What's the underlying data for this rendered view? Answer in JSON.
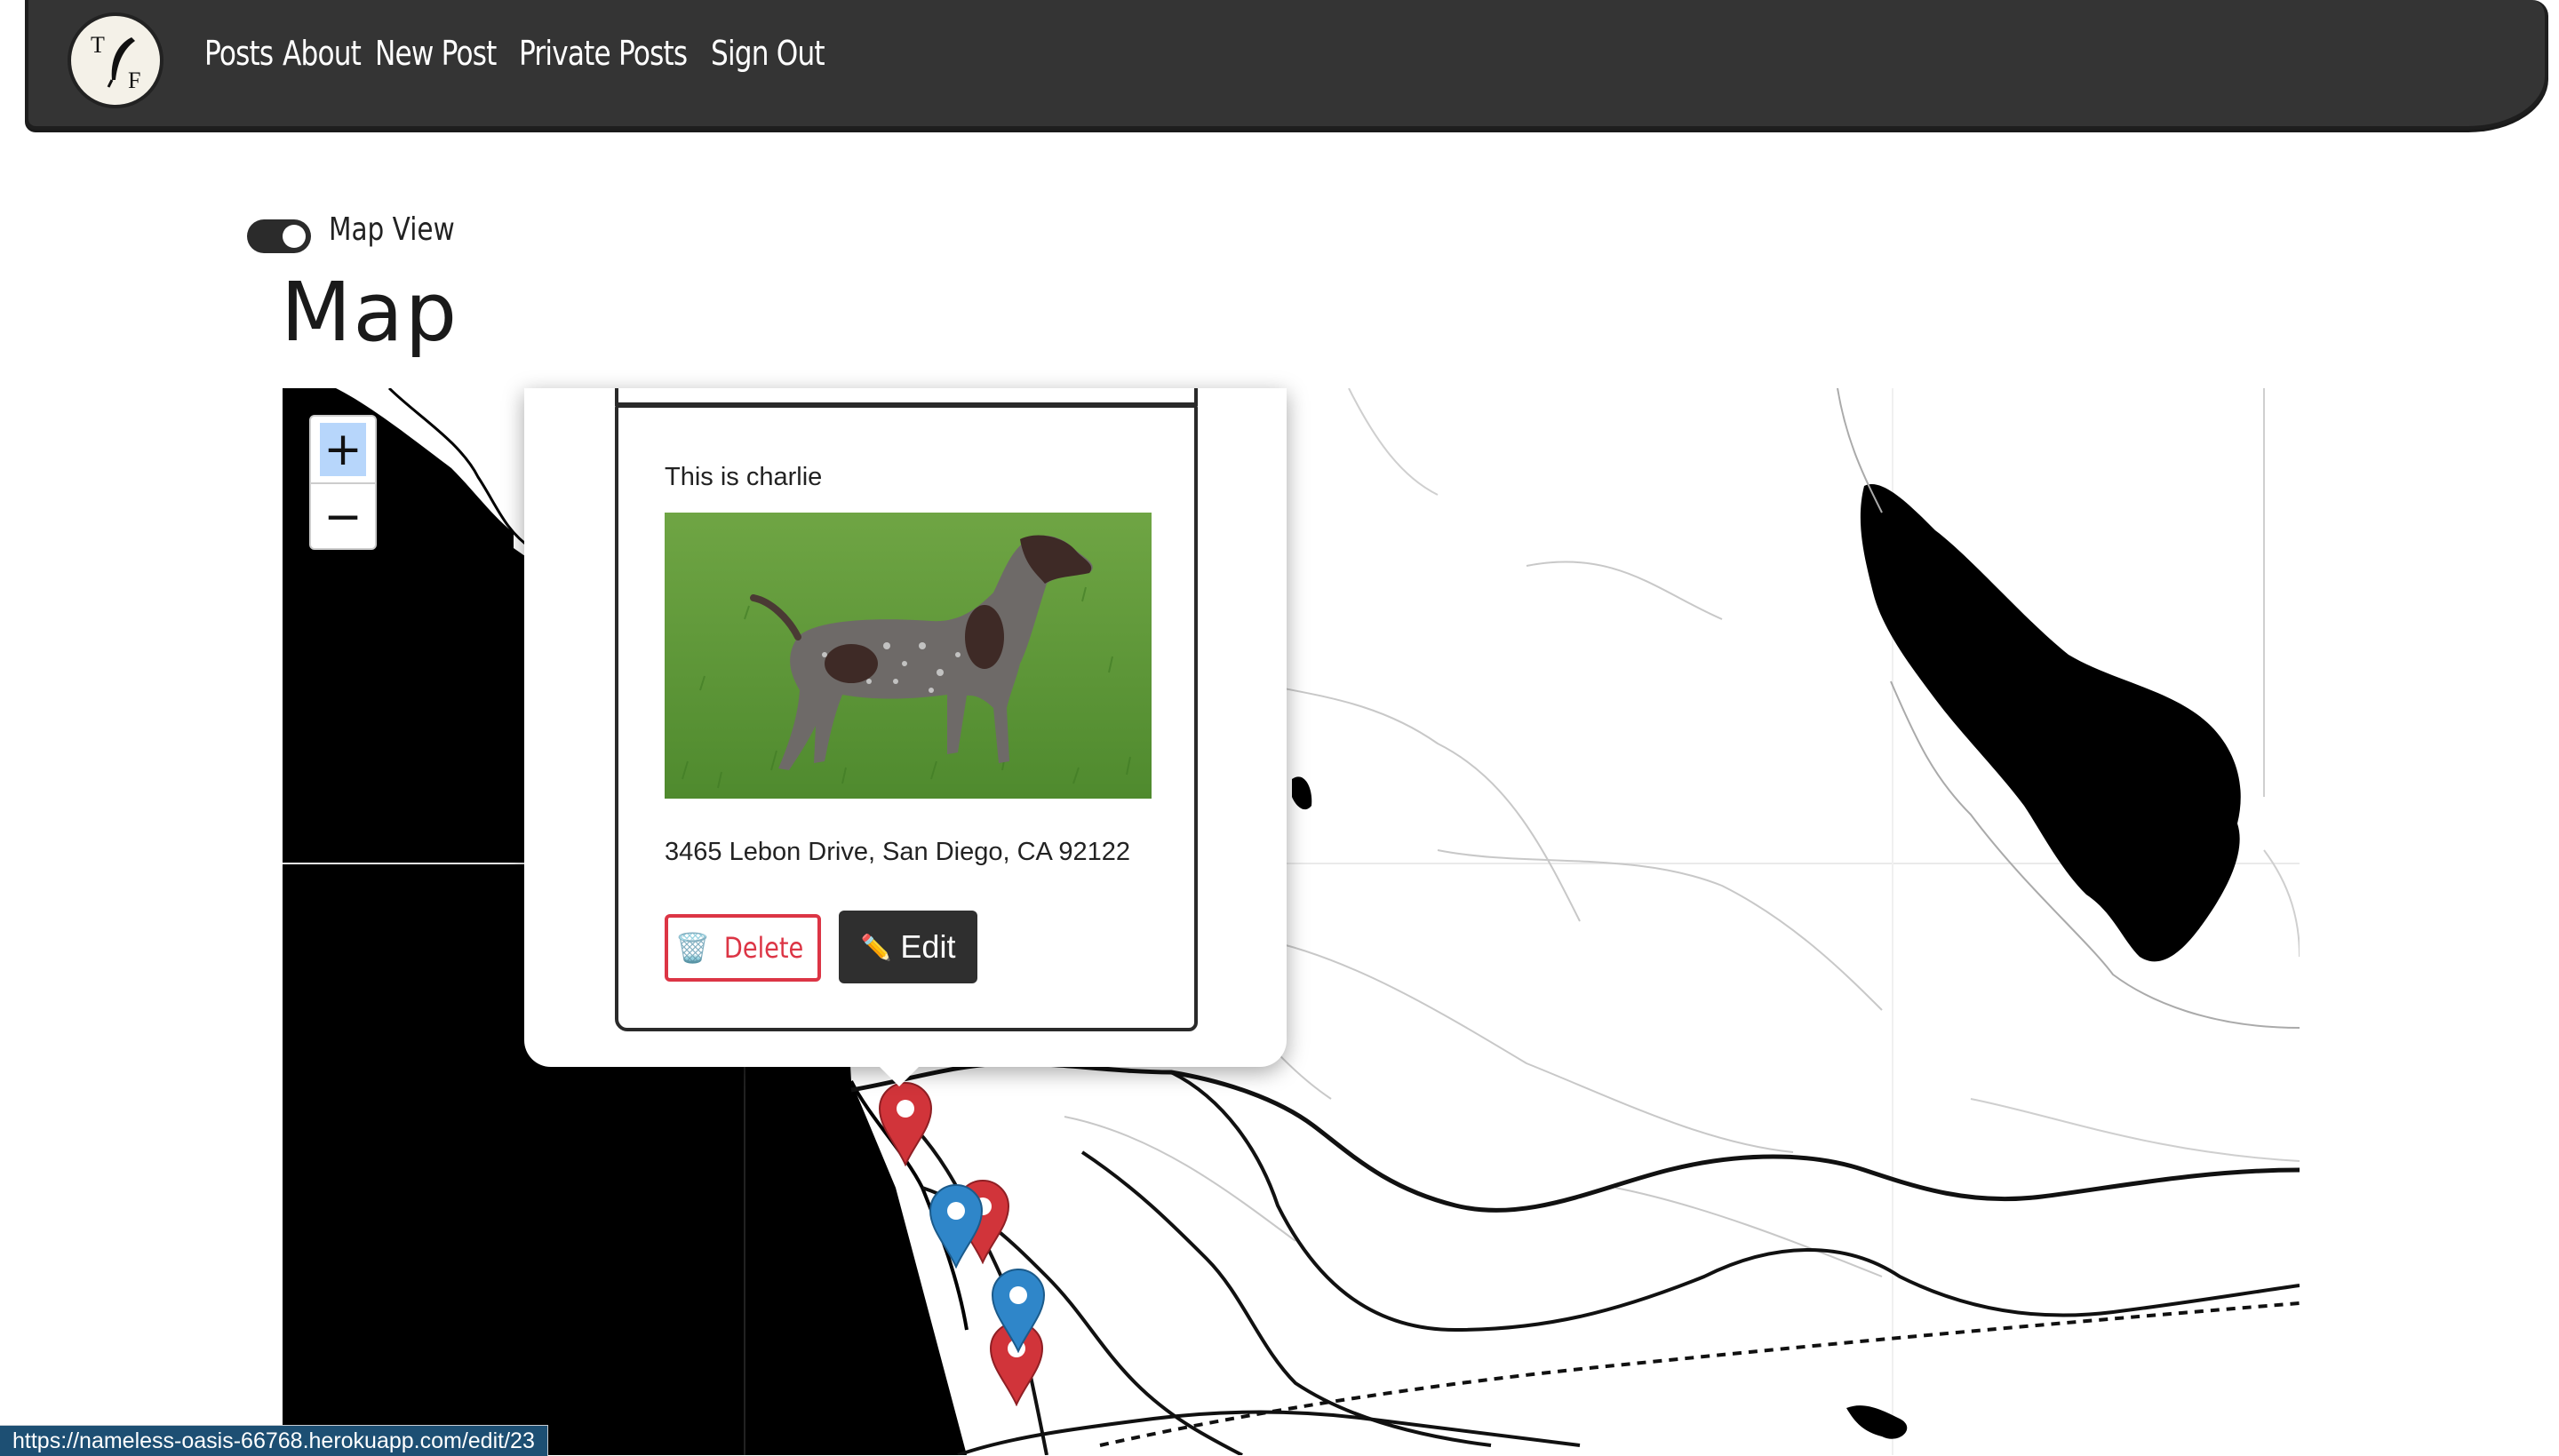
{
  "nav": {
    "logo_letters": {
      "top": "T",
      "bottom": "F"
    },
    "items": [
      {
        "label": "Posts"
      },
      {
        "label": "About"
      },
      {
        "label": "New Post"
      },
      {
        "label": "Private Posts"
      },
      {
        "label": "Sign Out"
      }
    ]
  },
  "toggle": {
    "label": "Map View",
    "checked": true
  },
  "page": {
    "title": "Map"
  },
  "map": {
    "zoom_in": "+",
    "zoom_out": "−",
    "markers": [
      {
        "color": "red"
      },
      {
        "color": "blue"
      },
      {
        "color": "red"
      },
      {
        "color": "blue"
      },
      {
        "color": "red"
      }
    ]
  },
  "popup": {
    "description": "This is charlie",
    "photo_subject": "dog-photo",
    "address": "3465 Lebon Drive, San Diego, CA 92122",
    "delete_label": "Delete",
    "edit_label": "Edit",
    "delete_icon": "trash-icon",
    "edit_icon": "pencil-icon"
  },
  "status_bar": {
    "url": "https://nameless-oasis-66768.herokuapp.com/edit/23"
  },
  "colors": {
    "navbar": "#343434",
    "delete": "#dc3545",
    "edit_bg": "#2f2f2f",
    "marker_red": "#d1343a",
    "marker_blue": "#2f86c9"
  }
}
